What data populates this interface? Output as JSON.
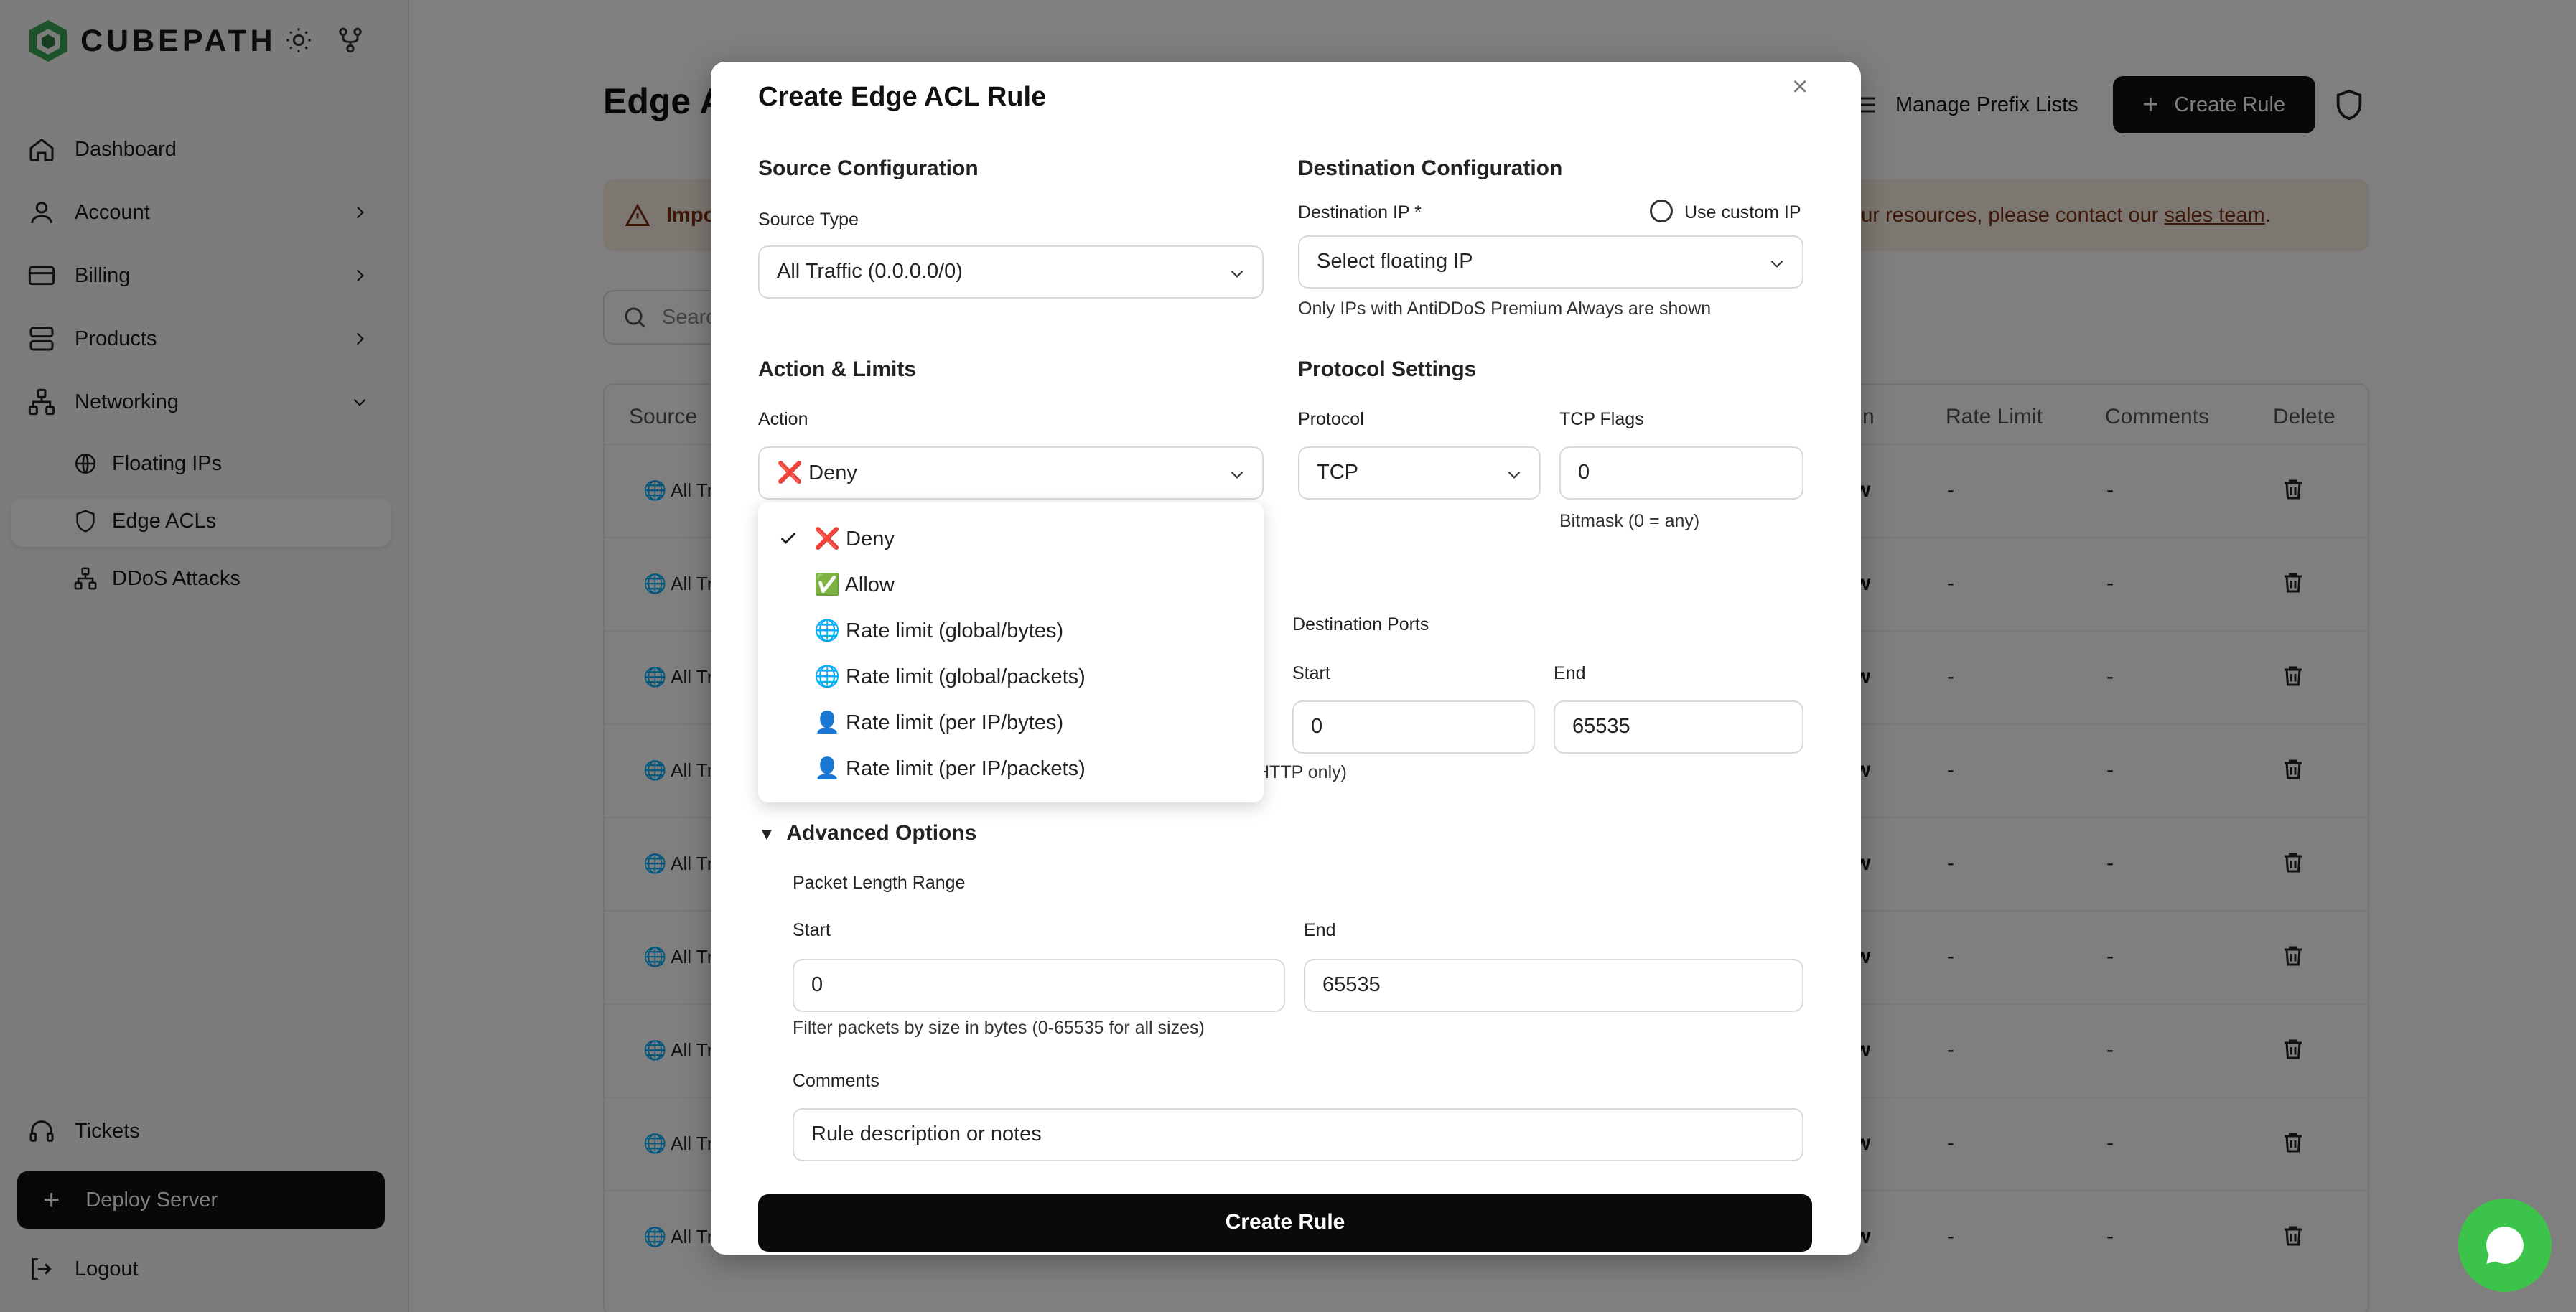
{
  "app": {
    "brand": "CUBEPATH"
  },
  "sidebar": {
    "items": [
      {
        "label": "Dashboard",
        "icon": "home-icon"
      },
      {
        "label": "Account",
        "icon": "user-icon"
      },
      {
        "label": "Billing",
        "icon": "credit-card-icon"
      },
      {
        "label": "Products",
        "icon": "server-icon"
      },
      {
        "label": "Networking",
        "icon": "network-icon"
      }
    ],
    "sub_items": [
      {
        "label": "Floating IPs",
        "icon": "globe-icon"
      },
      {
        "label": "Edge ACLs",
        "icon": "shield-icon"
      },
      {
        "label": "DDoS Attacks",
        "icon": "sitemap-icon"
      }
    ],
    "tickets": "Tickets",
    "deploy": "Deploy Server",
    "logout": "Logout"
  },
  "header": {
    "title": "Edge ACLs",
    "manage_prefix": "Manage Prefix Lists",
    "create_rule": "Create Rule"
  },
  "alert": {
    "strong": "Impo",
    "tail_pre": "our resources, please contact our ",
    "tail_link": "sales team",
    "tail_post": "."
  },
  "search": {
    "placeholder": "Searc"
  },
  "table": {
    "headers": {
      "source": "Source",
      "n": "n",
      "rate_limit": "Rate Limit",
      "comments": "Comments",
      "delete": "Delete"
    },
    "rows": [
      {
        "source": "🌐 All Tra",
        "rate": "-",
        "comments": "-"
      },
      {
        "source": "🌐 All Tra",
        "rate": "-",
        "comments": "-"
      },
      {
        "source": "🌐 All Tra",
        "rate": "-",
        "comments": "-"
      },
      {
        "source": "🌐 All Tra",
        "rate": "-",
        "comments": "-"
      },
      {
        "source": "🌐 All Tra",
        "rate": "-",
        "comments": "-"
      },
      {
        "source": "🌐 All Tra",
        "rate": "-",
        "comments": "-"
      },
      {
        "source": "🌐 All Tra",
        "rate": "-",
        "comments": "-"
      },
      {
        "source": "🌐 All Tra",
        "rate": "-",
        "comments": "-"
      },
      {
        "source": "🌐 All Tra",
        "rate": "-",
        "comments": "-"
      }
    ]
  },
  "modal": {
    "title": "Create Edge ACL Rule",
    "source": {
      "heading": "Source Configuration",
      "type_label": "Source Type",
      "type_value": "All Traffic (0.0.0.0/0)"
    },
    "destination": {
      "heading": "Destination Configuration",
      "ip_label": "Destination IP *",
      "custom_ip_label": "Use custom IP",
      "ip_placeholder": "Select floating IP",
      "ip_hint": "Only IPs with AntiDDoS Premium Always are shown"
    },
    "action": {
      "heading": "Action & Limits",
      "label": "Action",
      "value": "Deny",
      "options": [
        {
          "label": "Deny",
          "marker": "❌",
          "selected": true
        },
        {
          "label": "Allow",
          "marker": "✅",
          "selected": false
        },
        {
          "label": "Rate limit (global/bytes)",
          "marker": "🌐",
          "selected": false
        },
        {
          "label": "Rate limit (global/packets)",
          "marker": "🌐",
          "selected": false
        },
        {
          "label": "Rate limit (per IP/bytes)",
          "marker": "👤",
          "selected": false
        },
        {
          "label": "Rate limit (per IP/packets)",
          "marker": "👤",
          "selected": false
        }
      ]
    },
    "protocol": {
      "heading": "Protocol Settings",
      "protocol_label": "Protocol",
      "protocol_value": "TCP",
      "flags_label": "TCP Flags",
      "flags_value": "0",
      "flags_hint": "Bitmask (0 = any)"
    },
    "dest_ports": {
      "label": "Destination Ports",
      "start_label": "Start",
      "start_value": "0",
      "end_label": "End",
      "end_value": "65535",
      "partial_hint": "HTTP only)"
    },
    "advanced": {
      "heading": "Advanced Options",
      "packet_label": "Packet Length Range",
      "start_label": "Start",
      "start_value": "0",
      "end_label": "End",
      "end_value": "65535",
      "hint": "Filter packets by size in bytes (0-65535 for all sizes)",
      "comments_label": "Comments",
      "comments_placeholder": "Rule description or notes"
    },
    "submit": "Create Rule"
  },
  "colors": {
    "accent": "#111111",
    "chat": "#3cc34a",
    "alert_bg": "#fbeee2",
    "deny": "#e0241b"
  }
}
